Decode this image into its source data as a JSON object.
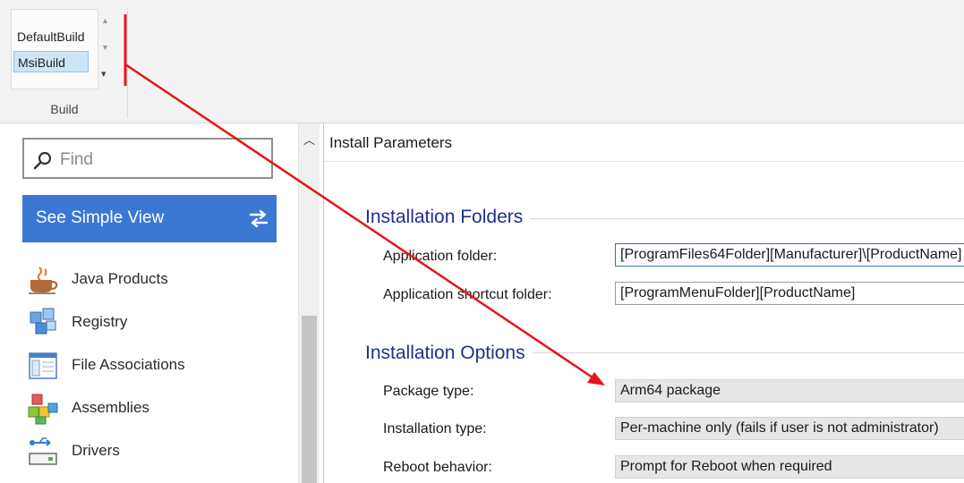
{
  "ribbon": {
    "gallery_items": [
      "DefaultBuild",
      "MsiBuild"
    ],
    "selected_item": "MsiBuild",
    "group_label": "Build"
  },
  "sidebar": {
    "search_placeholder": "Find",
    "simple_view_label": "See Simple View",
    "items": [
      {
        "label": "Java Products",
        "icon": "java-cup-icon"
      },
      {
        "label": "Registry",
        "icon": "registry-cubes-icon"
      },
      {
        "label": "File Associations",
        "icon": "file-associations-icon"
      },
      {
        "label": "Assemblies",
        "icon": "assemblies-blocks-icon"
      },
      {
        "label": "Drivers",
        "icon": "usb-driver-icon"
      }
    ]
  },
  "main": {
    "panel_title": "Install Parameters",
    "sections": [
      {
        "title": "Installation Folders",
        "fields": [
          {
            "label": "Application folder:",
            "value": "[ProgramFiles64Folder][Manufacturer]\\[ProductName]"
          },
          {
            "label": "Application shortcut folder:",
            "value": "[ProgramMenuFolder][ProductName]"
          }
        ]
      },
      {
        "title": "Installation Options",
        "fields": [
          {
            "label": "Package type:",
            "value": "Arm64 package"
          },
          {
            "label": "Installation type:",
            "value": "Per-machine only (fails if user is not administrator)"
          },
          {
            "label": "Reboot behavior:",
            "value": "Prompt for Reboot when required"
          }
        ]
      }
    ]
  },
  "colors": {
    "accent_blue": "#3a78d4",
    "section_title": "#1f2f8c",
    "annotation_red": "#e8141b",
    "selection": "#cde6f7"
  }
}
